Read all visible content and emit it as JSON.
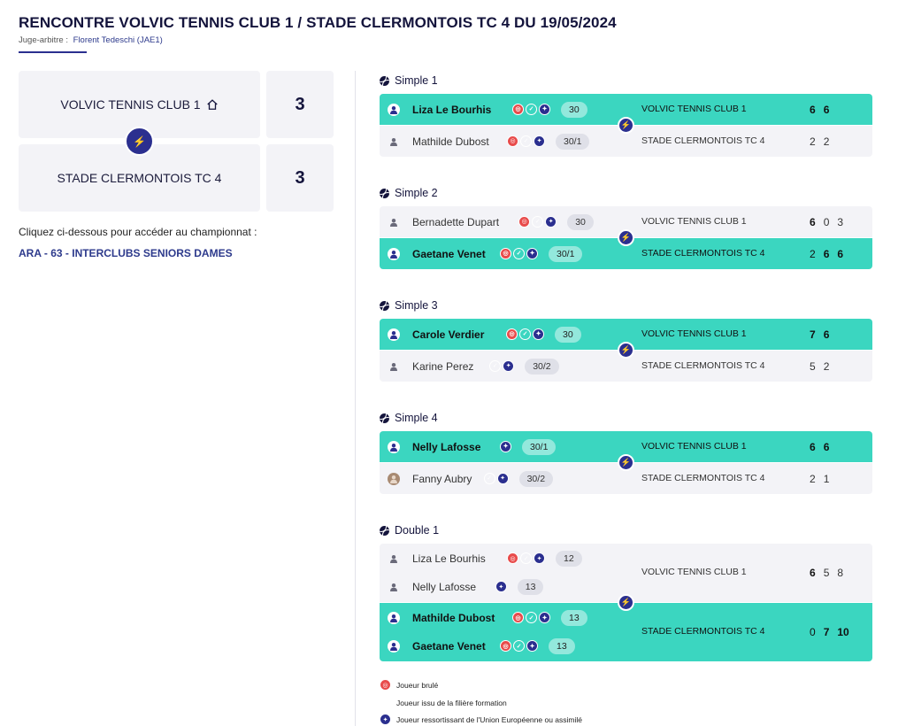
{
  "header": {
    "title": "RENCONTRE VOLVIC TENNIS CLUB 1 / STADE CLERMONTOIS TC 4 DU 19/05/2024",
    "referee_label": "Juge-arbitre :",
    "referee_name": "Florent Tedeschi (JAE1)"
  },
  "summary": {
    "home_team": "VOLVIC TENNIS CLUB 1",
    "home_score": "3",
    "away_team": "STADE CLERMONTOIS TC 4",
    "away_score": "3",
    "home_icon": "house-icon",
    "vs_icon": "lightning-icon"
  },
  "championship": {
    "intro": "Cliquez ci-dessous pour accéder au championnat :",
    "link": "ARA - 63 - INTERCLUBS SENIORS DAMES"
  },
  "colors": {
    "accent": "#2b2f8f",
    "winner": "#3bd6c0",
    "burn": "#e84b4b",
    "formation": "#3bcfc4",
    "eu": "#2b2f8f"
  },
  "matches": [
    {
      "title": "Simple 1",
      "rows": [
        {
          "players": [
            {
              "name": "Liza Le Bourhis",
              "badges": [
                "burn",
                "formation",
                "eu"
              ],
              "rank": "30"
            }
          ],
          "club": "VOLVIC TENNIS CLUB 1",
          "sets": [
            "6",
            "6"
          ],
          "won": [
            true,
            true
          ],
          "winner": true
        },
        {
          "players": [
            {
              "name": "Mathilde Dubost",
              "badges": [
                "burn",
                "formation",
                "eu"
              ],
              "rank": "30/1"
            }
          ],
          "club": "STADE CLERMONTOIS TC 4",
          "sets": [
            "2",
            "2"
          ],
          "won": [
            false,
            false
          ],
          "winner": false
        }
      ]
    },
    {
      "title": "Simple 2",
      "rows": [
        {
          "players": [
            {
              "name": "Bernadette Dupart",
              "badges": [
                "burn",
                "formation",
                "eu"
              ],
              "rank": "30"
            }
          ],
          "club": "VOLVIC TENNIS CLUB 1",
          "sets": [
            "6",
            "0",
            "3"
          ],
          "won": [
            true,
            false,
            false
          ],
          "winner": false
        },
        {
          "players": [
            {
              "name": "Gaetane Venet",
              "badges": [
                "burn",
                "formation",
                "eu"
              ],
              "rank": "30/1"
            }
          ],
          "club": "STADE CLERMONTOIS TC 4",
          "sets": [
            "2",
            "6",
            "6"
          ],
          "won": [
            false,
            true,
            true
          ],
          "winner": true
        }
      ]
    },
    {
      "title": "Simple 3",
      "rows": [
        {
          "players": [
            {
              "name": "Carole Verdier",
              "badges": [
                "burn",
                "formation",
                "eu"
              ],
              "rank": "30"
            }
          ],
          "club": "VOLVIC TENNIS CLUB 1",
          "sets": [
            "7",
            "6"
          ],
          "won": [
            true,
            true
          ],
          "winner": true
        },
        {
          "players": [
            {
              "name": "Karine Perez",
              "badges": [
                "formation",
                "eu"
              ],
              "rank": "30/2"
            }
          ],
          "club": "STADE CLERMONTOIS TC 4",
          "sets": [
            "5",
            "2"
          ],
          "won": [
            false,
            false
          ],
          "winner": false
        }
      ]
    },
    {
      "title": "Simple 4",
      "rows": [
        {
          "players": [
            {
              "name": "Nelly Lafosse",
              "badges": [
                "eu"
              ],
              "rank": "30/1"
            }
          ],
          "club": "VOLVIC TENNIS CLUB 1",
          "sets": [
            "6",
            "6"
          ],
          "won": [
            true,
            true
          ],
          "winner": true
        },
        {
          "players": [
            {
              "name": "Fanny Aubry",
              "badges": [
                "formation",
                "eu"
              ],
              "rank": "30/2",
              "photo": true
            }
          ],
          "club": "STADE CLERMONTOIS TC 4",
          "sets": [
            "2",
            "1"
          ],
          "won": [
            false,
            false
          ],
          "winner": false
        }
      ]
    },
    {
      "title": "Double 1",
      "rows": [
        {
          "players": [
            {
              "name": "Liza Le Bourhis",
              "badges": [
                "burn",
                "formation",
                "eu"
              ],
              "rank": "12"
            },
            {
              "name": "Nelly Lafosse",
              "badges": [
                "eu"
              ],
              "rank": "13"
            }
          ],
          "club": "VOLVIC TENNIS CLUB 1",
          "sets": [
            "6",
            "5",
            "8"
          ],
          "won": [
            true,
            false,
            false
          ],
          "winner": false
        },
        {
          "players": [
            {
              "name": "Mathilde Dubost",
              "badges": [
                "burn",
                "formation",
                "eu"
              ],
              "rank": "13"
            },
            {
              "name": "Gaetane Venet",
              "badges": [
                "burn",
                "formation",
                "eu"
              ],
              "rank": "13"
            }
          ],
          "club": "STADE CLERMONTOIS TC 4",
          "sets": [
            "0",
            "7",
            "10"
          ],
          "won": [
            false,
            true,
            true
          ],
          "winner": true
        }
      ]
    }
  ],
  "legend": [
    {
      "badge": "burn",
      "label": "Joueur brulé"
    },
    {
      "badge": "formation",
      "label": "Joueur issu de la filière formation"
    },
    {
      "badge": "eu",
      "label": "Joueur ressortissant de l'Union Européenne ou assimilé"
    }
  ]
}
